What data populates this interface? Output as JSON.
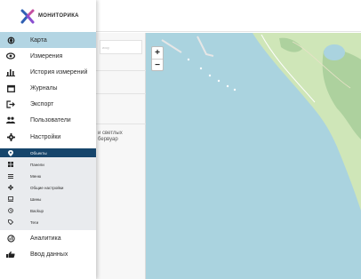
{
  "brand": {
    "name": "МОНИТОРИКА"
  },
  "menu": [
    {
      "key": "map",
      "label": "Карта",
      "icon": "map-pin-icon",
      "active": true
    },
    {
      "key": "measurements",
      "label": "Измерения",
      "icon": "eye-icon"
    },
    {
      "key": "history",
      "label": "История измерений",
      "icon": "bar-chart-icon"
    },
    {
      "key": "journals",
      "label": "Журналы",
      "icon": "calendar-icon"
    },
    {
      "key": "export",
      "label": "Экспорт",
      "icon": "export-icon"
    },
    {
      "key": "users",
      "label": "Пользователи",
      "icon": "users-icon"
    },
    {
      "key": "settings",
      "label": "Настройки",
      "icon": "gear-icon"
    }
  ],
  "submenu": [
    {
      "label": "Объекты",
      "icon": "location-icon",
      "active": true
    },
    {
      "label": "Панели",
      "icon": "dashboard-icon"
    },
    {
      "label": "Меню",
      "icon": "menu-icon"
    },
    {
      "label": "Общие настройки",
      "icon": "gear-icon"
    },
    {
      "label": "Шины",
      "icon": "bus-icon"
    },
    {
      "label": "Backup",
      "icon": "backup-icon"
    },
    {
      "label": "Теги",
      "icon": "tag-icon"
    }
  ],
  "menu_bottom": [
    {
      "label": "Аналитика",
      "icon": "analytics-icon"
    },
    {
      "label": "Ввод данных",
      "icon": "hand-pointer-icon"
    }
  ],
  "panel": {
    "search_placeholder": "иску",
    "desc_line1": "и светлых",
    "desc_line2": "бервуар"
  },
  "map": {
    "zoom_in": "+",
    "zoom_out": "−",
    "colors": {
      "water": "#aad3df",
      "land": "#cfe6b8",
      "wood": "#add19e"
    }
  }
}
